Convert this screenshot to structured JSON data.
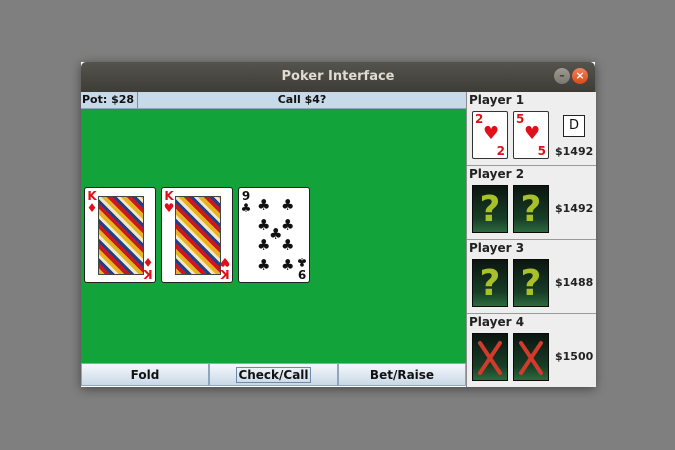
{
  "window": {
    "title": "Poker Interface",
    "minimize_glyph": "–",
    "close_glyph": "×"
  },
  "status": {
    "pot": "Pot: $28",
    "prompt": "Call $4?"
  },
  "community": {
    "cards": [
      {
        "rank": "K",
        "suit": "♦",
        "color": "red",
        "name": "king-of-diamonds"
      },
      {
        "rank": "K",
        "suit": "♥",
        "color": "red",
        "name": "king-of-hearts"
      },
      {
        "rank": "9",
        "suit": "♣",
        "color": "black",
        "name": "nine-of-clubs"
      }
    ]
  },
  "actions": {
    "fold": "Fold",
    "check_call": "Check/Call",
    "bet_raise": "Bet/Raise"
  },
  "players": [
    {
      "name": "Player 1",
      "money": "$1492",
      "dealer": "D",
      "cards": [
        {
          "rank": "2",
          "suit": "♥"
        },
        {
          "rank": "5",
          "suit": "♥"
        }
      ]
    },
    {
      "name": "Player 2",
      "money": "$1492",
      "back_glyph": "?"
    },
    {
      "name": "Player 3",
      "money": "$1488",
      "back_glyph": "?"
    },
    {
      "name": "Player 4",
      "money": "$1500",
      "status": "folded"
    }
  ],
  "colors": {
    "felt": "#12a33a",
    "heart": "#e0101a",
    "cardback_question": "#a8c02a",
    "folded_x": "#d23b2a"
  }
}
